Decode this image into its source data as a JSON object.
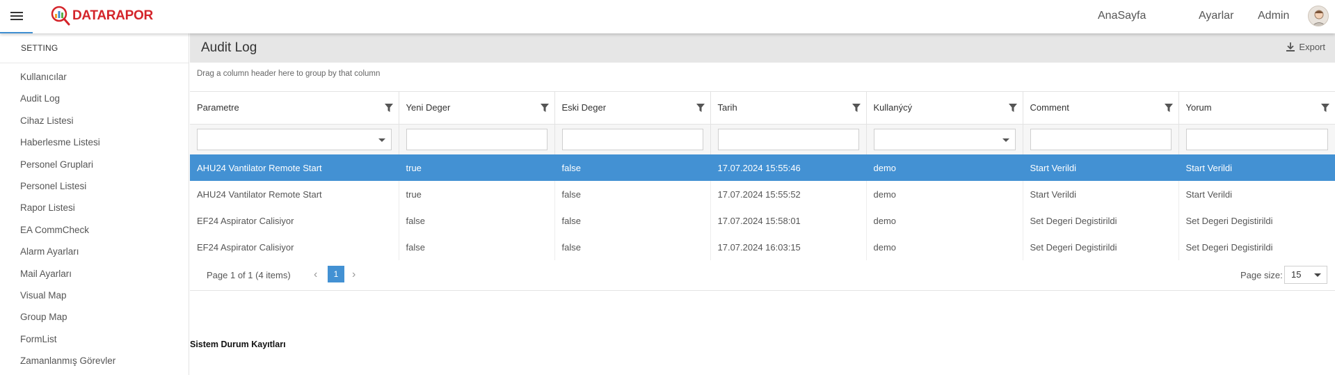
{
  "header": {
    "logo_text": "DATARAPOR",
    "nav": [
      "AnaSayfa",
      "Ayarlar",
      "Admin"
    ]
  },
  "sidebar": {
    "title": "SETTING",
    "items": [
      "Kullanıcılar",
      "Audit Log",
      "Cihaz Listesi",
      "Haberlesme Listesi",
      "Personel Gruplari",
      "Personel Listesi",
      "Rapor Listesi",
      "EA CommCheck",
      "Alarm Ayarları",
      "Mail Ayarları",
      "Visual Map",
      "Group Map",
      "FormList",
      "Zamanlanmış Görevler"
    ]
  },
  "main": {
    "title": "Audit Log",
    "export_label": "Export",
    "group_hint": "Drag a column header here to group by that column",
    "columns": [
      "Parametre",
      "Yeni Deger",
      "Eski Deger",
      "Tarih",
      "Kullanýcý",
      "Comment",
      "Yorum"
    ],
    "rows": [
      [
        "AHU24 Vantilator Remote Start",
        "true",
        "false",
        "17.07.2024 15:55:46",
        "demo",
        "Start Verildi",
        "Start Verildi"
      ],
      [
        "AHU24 Vantilator Remote Start",
        "true",
        "false",
        "17.07.2024 15:55:52",
        "demo",
        "Start Verildi",
        "Start Verildi"
      ],
      [
        "EF24 Aspirator Calisiyor",
        "false",
        "false",
        "17.07.2024 15:58:01",
        "demo",
        "Set Degeri Degistirildi",
        "Set Degeri Degistirildi"
      ],
      [
        "EF24 Aspirator Calisiyor",
        "false",
        "false",
        "17.07.2024 16:03:15",
        "demo",
        "Set Degeri Degistirildi",
        "Set Degeri Degistirildi"
      ]
    ],
    "selected_row": 0,
    "pager": {
      "info": "Page 1 of 1 (4 items)",
      "current_page": "1",
      "page_size_label": "Page size:",
      "page_size": "15"
    },
    "section_title": "Sistem Durum Kayıtları"
  },
  "colors": {
    "accent": "#4391d3",
    "brand": "#d4242a"
  }
}
